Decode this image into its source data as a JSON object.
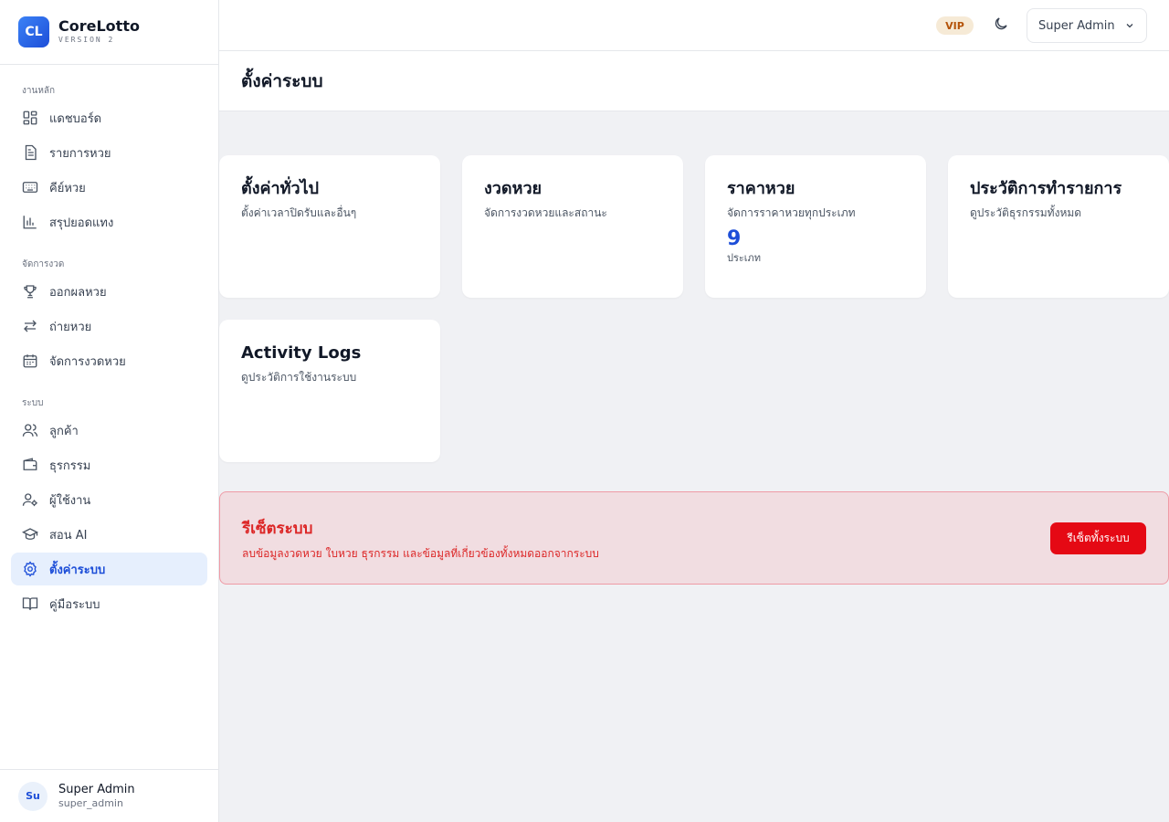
{
  "brand": {
    "logo": "CL",
    "name": "CoreLotto",
    "version": "VERSION 2"
  },
  "sidebar": {
    "sections": [
      {
        "title": "งานหลัก",
        "items": [
          {
            "label": "แดชบอร์ด",
            "icon": "grid-icon"
          },
          {
            "label": "รายการหวย",
            "icon": "document-icon"
          },
          {
            "label": "คีย์หวย",
            "icon": "keyboard-icon"
          },
          {
            "label": "สรุปยอดแทง",
            "icon": "bar-chart-icon"
          }
        ]
      },
      {
        "title": "จัดการงวด",
        "items": [
          {
            "label": "ออกผลหวย",
            "icon": "trophy-icon"
          },
          {
            "label": "ถ่ายหวย",
            "icon": "arrows-swap-icon"
          },
          {
            "label": "จัดการงวดหวย",
            "icon": "calendar-icon"
          }
        ]
      },
      {
        "title": "ระบบ",
        "items": [
          {
            "label": "ลูกค้า",
            "icon": "users-icon"
          },
          {
            "label": "ธุรกรรม",
            "icon": "wallet-icon"
          },
          {
            "label": "ผู้ใช้งาน",
            "icon": "user-gear-icon"
          },
          {
            "label": "สอน AI",
            "icon": "graduation-cap-icon"
          },
          {
            "label": "ตั้งค่าระบบ",
            "icon": "gear-icon",
            "active": true
          },
          {
            "label": "คู่มือระบบ",
            "icon": "book-icon"
          }
        ]
      }
    ],
    "user": {
      "initials": "Su",
      "name": "Super Admin",
      "handle": "super_admin"
    }
  },
  "topbar": {
    "badge": "VIP",
    "user_menu": "Super Admin"
  },
  "page": {
    "title": "ตั้งค่าระบบ"
  },
  "cards": [
    {
      "title": "ตั้งค่าทั่วไป",
      "desc": "ตั้งค่าเวลาปิดรับและอื่นๆ"
    },
    {
      "title": "งวดหวย",
      "desc": "จัดการงวดหวยและสถานะ"
    },
    {
      "title": "ราคาหวย",
      "desc": "จัดการราคาหวยทุกประเภท",
      "stat": "9",
      "unit": "ประเภท"
    },
    {
      "title": "ประวัติการทำรายการ",
      "desc": "ดูประวัติธุรกรรมทั้งหมด"
    },
    {
      "title": "Activity Logs",
      "desc": "ดูประวัติการใช้งานระบบ"
    }
  ],
  "danger": {
    "title": "รีเซ็ตระบบ",
    "desc": "ลบข้อมูลงวดหวย ใบหวย ธุรกรรม และข้อมูลที่เกี่ยวข้องทั้งหมดออกจากระบบ",
    "button": "รีเซ็ตทั้งระบบ"
  },
  "colors": {
    "accent": "#1d4ed8",
    "danger": "#dc2626",
    "danger_button": "#e50914",
    "active_bg": "#e6effd"
  }
}
